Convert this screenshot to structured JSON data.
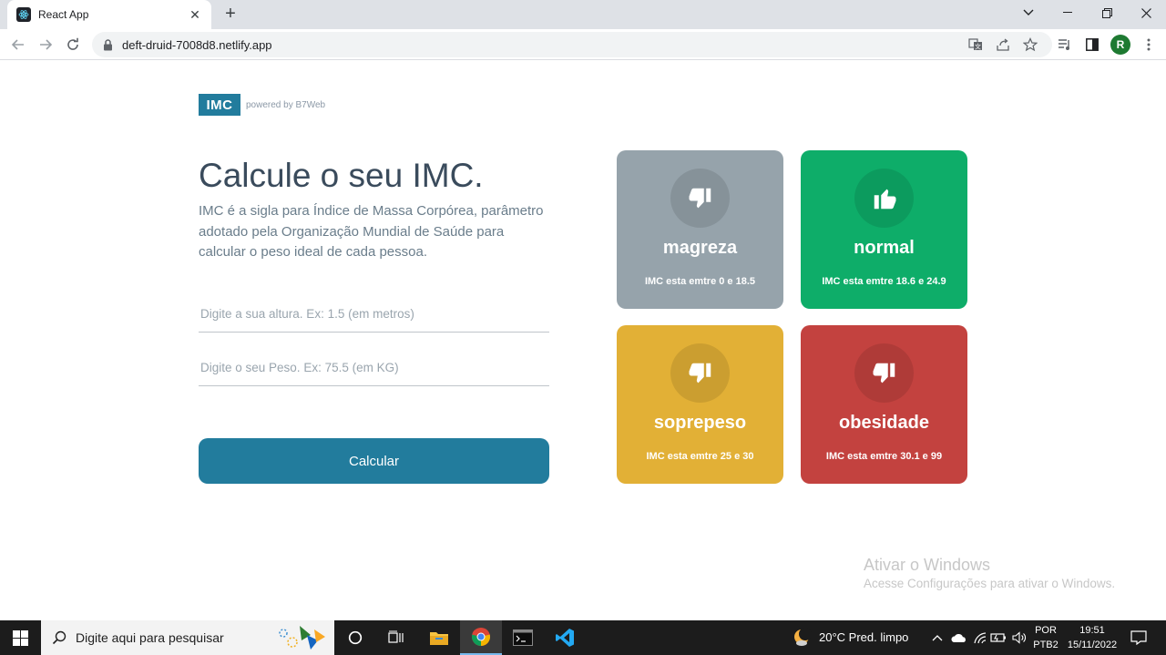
{
  "browser": {
    "tab_title": "React App",
    "url": "deft-druid-7008d8.netlify.app",
    "profile_initial": "R"
  },
  "header": {
    "logo_text": "IMC",
    "powered_by": "powered by B7Web"
  },
  "main": {
    "title": "Calcule o seu IMC.",
    "description": "IMC é a sigla para Índice de Massa Corpórea, parâmetro adotado pela Organização Mundial de Saúde para calcular o peso ideal de cada pessoa.",
    "height_placeholder": "Digite a sua altura. Ex: 1.5 (em metros)",
    "weight_placeholder": "Digite o seu Peso. Ex: 75.5 (em KG)",
    "button_label": "Calcular"
  },
  "cards": [
    {
      "name": "magreza",
      "range": "IMC esta emtre 0 e 18.5",
      "color": "#96a3ab",
      "icon": "thumbs-down-icon"
    },
    {
      "name": "normal",
      "range": "IMC esta emtre 18.6 e 24.9",
      "color": "#0ead69",
      "icon": "thumbs-up-icon"
    },
    {
      "name": "soprepeso",
      "range": "IMC esta emtre 25 e 30",
      "color": "#e2b036",
      "icon": "thumbs-down-icon"
    },
    {
      "name": "obesidade",
      "range": "IMC esta emtre 30.1 e 99",
      "color": "#c3423f",
      "icon": "thumbs-down-icon"
    }
  ],
  "watermark": {
    "line1": "Ativar o Windows",
    "line2": "Acesse Configurações para ativar o Windows."
  },
  "taskbar": {
    "search_placeholder": "Digite aqui para pesquisar",
    "weather": "20°C  Pred. limpo",
    "lang_top": "POR",
    "lang_bottom": "PTB2",
    "time": "19:51",
    "date": "15/11/2022"
  }
}
